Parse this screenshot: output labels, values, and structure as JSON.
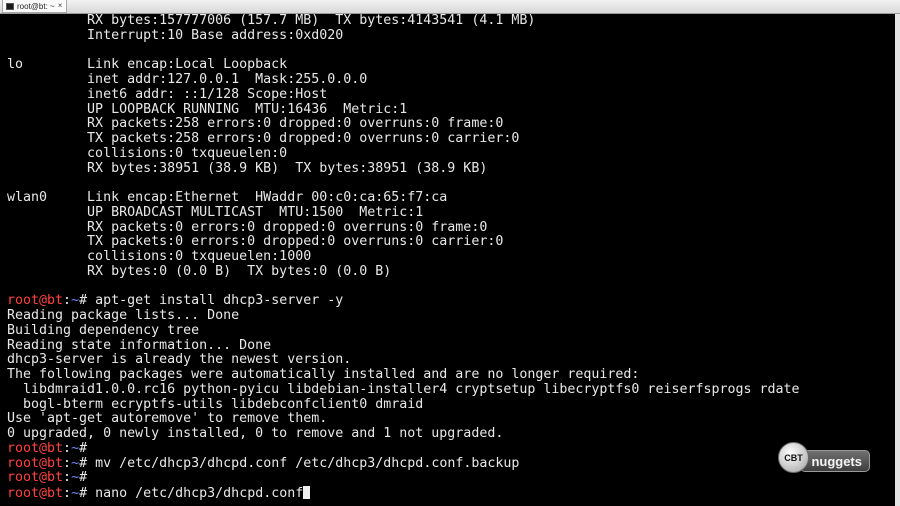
{
  "window": {
    "tab_title": "root@bt: ~",
    "tab_icon": "terminal-icon",
    "close_glyph": "×"
  },
  "colors": {
    "prompt_user": "#ff4040",
    "prompt_path": "#6f8cff",
    "text": "#e8e8e8",
    "background": "#000000"
  },
  "terminal": {
    "lines": [
      {
        "type": "out",
        "text": "          RX bytes:157777006 (157.7 MB)  TX bytes:4143541 (4.1 MB)"
      },
      {
        "type": "out",
        "text": "          Interrupt:10 Base address:0xd020"
      },
      {
        "type": "out",
        "text": ""
      },
      {
        "type": "out",
        "text": "lo        Link encap:Local Loopback"
      },
      {
        "type": "out",
        "text": "          inet addr:127.0.0.1  Mask:255.0.0.0"
      },
      {
        "type": "out",
        "text": "          inet6 addr: ::1/128 Scope:Host"
      },
      {
        "type": "out",
        "text": "          UP LOOPBACK RUNNING  MTU:16436  Metric:1"
      },
      {
        "type": "out",
        "text": "          RX packets:258 errors:0 dropped:0 overruns:0 frame:0"
      },
      {
        "type": "out",
        "text": "          TX packets:258 errors:0 dropped:0 overruns:0 carrier:0"
      },
      {
        "type": "out",
        "text": "          collisions:0 txqueuelen:0"
      },
      {
        "type": "out",
        "text": "          RX bytes:38951 (38.9 KB)  TX bytes:38951 (38.9 KB)"
      },
      {
        "type": "out",
        "text": ""
      },
      {
        "type": "out",
        "text": "wlan0     Link encap:Ethernet  HWaddr 00:c0:ca:65:f7:ca"
      },
      {
        "type": "out",
        "text": "          UP BROADCAST MULTICAST  MTU:1500  Metric:1"
      },
      {
        "type": "out",
        "text": "          RX packets:0 errors:0 dropped:0 overruns:0 frame:0"
      },
      {
        "type": "out",
        "text": "          TX packets:0 errors:0 dropped:0 overruns:0 carrier:0"
      },
      {
        "type": "out",
        "text": "          collisions:0 txqueuelen:1000"
      },
      {
        "type": "out",
        "text": "          RX bytes:0 (0.0 B)  TX bytes:0 (0.0 B)"
      },
      {
        "type": "out",
        "text": ""
      },
      {
        "type": "cmd",
        "user": "root@bt",
        "sep": ":",
        "path": "~",
        "sym": "# ",
        "text": "apt-get install dhcp3-server -y"
      },
      {
        "type": "out",
        "text": "Reading package lists... Done"
      },
      {
        "type": "out",
        "text": "Building dependency tree"
      },
      {
        "type": "out",
        "text": "Reading state information... Done"
      },
      {
        "type": "out",
        "text": "dhcp3-server is already the newest version."
      },
      {
        "type": "out",
        "text": "The following packages were automatically installed and are no longer required:"
      },
      {
        "type": "out",
        "text": "  libdmraid1.0.0.rc16 python-pyicu libdebian-installer4 cryptsetup libecryptfs0 reiserfsprogs rdate"
      },
      {
        "type": "out",
        "text": "  bogl-bterm ecryptfs-utils libdebconfclient0 dmraid"
      },
      {
        "type": "out",
        "text": "Use 'apt-get autoremove' to remove them."
      },
      {
        "type": "out",
        "text": "0 upgraded, 0 newly installed, 0 to remove and 1 not upgraded."
      },
      {
        "type": "cmd",
        "user": "root@bt",
        "sep": ":",
        "path": "~",
        "sym": "# ",
        "text": ""
      },
      {
        "type": "cmd",
        "user": "root@bt",
        "sep": ":",
        "path": "~",
        "sym": "# ",
        "text": "mv /etc/dhcp3/dhcpd.conf /etc/dhcp3/dhcpd.conf.backup"
      },
      {
        "type": "cmd",
        "user": "root@bt",
        "sep": ":",
        "path": "~",
        "sym": "# ",
        "text": ""
      },
      {
        "type": "cmd",
        "user": "root@bt",
        "sep": ":",
        "path": "~",
        "sym": "# ",
        "text": "nano /etc/dhcp3/dhcpd.conf",
        "cursor": true
      }
    ]
  },
  "watermark": {
    "bubble_text": "CBT",
    "pill_text": "nuggets"
  }
}
